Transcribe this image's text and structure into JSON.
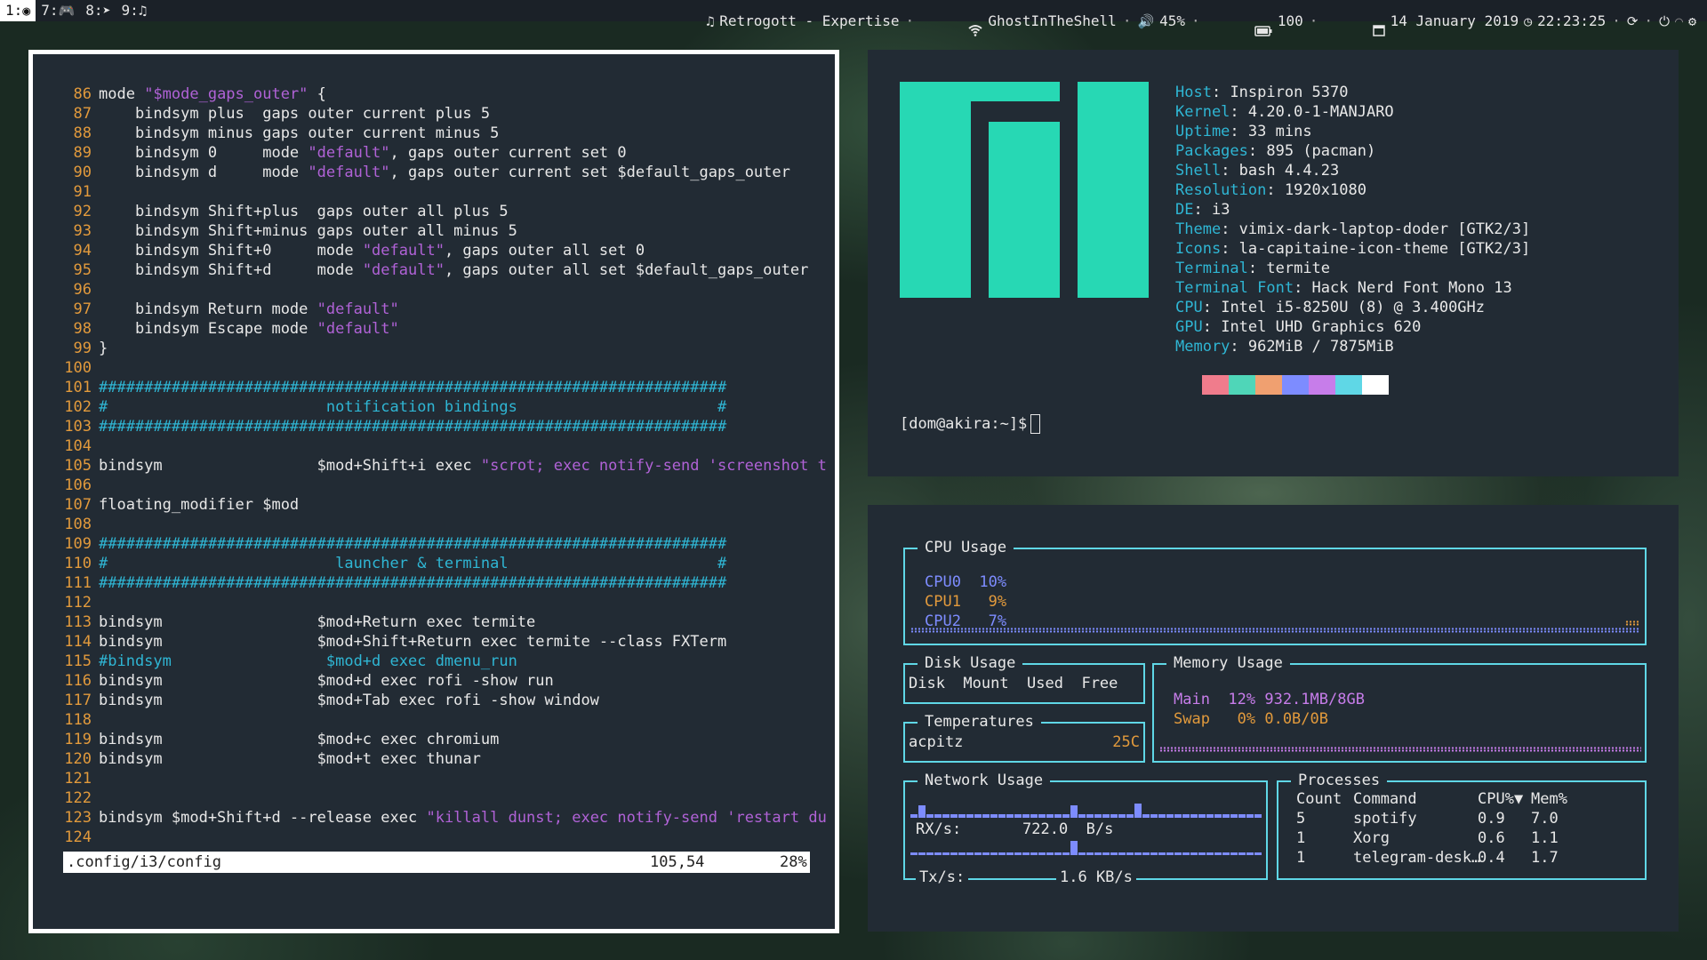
{
  "bar": {
    "workspaces": [
      {
        "label": "1:",
        "icon": "chrome-icon",
        "focused": true
      },
      {
        "label": "7:",
        "icon": "gamepad-icon",
        "focused": false
      },
      {
        "label": "8:",
        "icon": "send-icon",
        "focused": false
      },
      {
        "label": "9:",
        "icon": "music-icon",
        "focused": false
      }
    ],
    "now_playing": "Retrogott - Expertise",
    "wifi": "GhostInTheShell",
    "volume": "45%",
    "battery": "100",
    "date": "14 January 2019",
    "time": "22:23:25"
  },
  "editor": {
    "lines": [
      {
        "n": "86",
        "parts": [
          [
            "t",
            "mode "
          ],
          [
            "s",
            "\"$mode_gaps_outer\""
          ],
          [
            "t",
            " {"
          ]
        ]
      },
      {
        "n": "87",
        "parts": [
          [
            "t",
            "    bindsym plus  gaps outer current plus 5"
          ]
        ]
      },
      {
        "n": "88",
        "parts": [
          [
            "t",
            "    bindsym minus gaps outer current minus 5"
          ]
        ]
      },
      {
        "n": "89",
        "parts": [
          [
            "t",
            "    bindsym 0     mode "
          ],
          [
            "s",
            "\"default\""
          ],
          [
            "t",
            ", gaps outer current set 0"
          ]
        ]
      },
      {
        "n": "90",
        "parts": [
          [
            "t",
            "    bindsym d     mode "
          ],
          [
            "s",
            "\"default\""
          ],
          [
            "t",
            ", gaps outer current set $default_gaps_outer"
          ]
        ]
      },
      {
        "n": "91",
        "parts": []
      },
      {
        "n": "92",
        "parts": [
          [
            "t",
            "    bindsym Shift+plus  gaps outer all plus 5"
          ]
        ]
      },
      {
        "n": "93",
        "parts": [
          [
            "t",
            "    bindsym Shift+minus gaps outer all minus 5"
          ]
        ]
      },
      {
        "n": "94",
        "parts": [
          [
            "t",
            "    bindsym Shift+0     mode "
          ],
          [
            "s",
            "\"default\""
          ],
          [
            "t",
            ", gaps outer all set 0"
          ]
        ]
      },
      {
        "n": "95",
        "parts": [
          [
            "t",
            "    bindsym Shift+d     mode "
          ],
          [
            "s",
            "\"default\""
          ],
          [
            "t",
            ", gaps outer all set $default_gaps_outer"
          ]
        ]
      },
      {
        "n": "96",
        "parts": []
      },
      {
        "n": "97",
        "parts": [
          [
            "t",
            "    bindsym Return mode "
          ],
          [
            "s",
            "\"default\""
          ]
        ]
      },
      {
        "n": "98",
        "parts": [
          [
            "t",
            "    bindsym Escape mode "
          ],
          [
            "s",
            "\"default\""
          ]
        ]
      },
      {
        "n": "99",
        "parts": [
          [
            "t",
            "}"
          ]
        ]
      },
      {
        "n": "100",
        "parts": []
      },
      {
        "n": "101",
        "parts": [
          [
            "c",
            "#####################################################################"
          ]
        ]
      },
      {
        "n": "102",
        "parts": [
          [
            "c",
            "#                        notification bindings                      #"
          ]
        ]
      },
      {
        "n": "103",
        "parts": [
          [
            "c",
            "#####################################################################"
          ]
        ]
      },
      {
        "n": "104",
        "parts": []
      },
      {
        "n": "105",
        "parts": [
          [
            "t",
            "bindsym                 $mod+Shift+i exec "
          ],
          [
            "s",
            "\"scrot; exec notify-send 'screenshot t"
          ]
        ]
      },
      {
        "n": "106",
        "parts": []
      },
      {
        "n": "107",
        "parts": [
          [
            "t",
            "floating_modifier $mod"
          ]
        ]
      },
      {
        "n": "108",
        "parts": []
      },
      {
        "n": "109",
        "parts": [
          [
            "c",
            "#####################################################################"
          ]
        ]
      },
      {
        "n": "110",
        "parts": [
          [
            "c",
            "#                         launcher & terminal                       #"
          ]
        ]
      },
      {
        "n": "111",
        "parts": [
          [
            "c",
            "#####################################################################"
          ]
        ]
      },
      {
        "n": "112",
        "parts": []
      },
      {
        "n": "113",
        "parts": [
          [
            "t",
            "bindsym                 $mod+Return exec termite"
          ]
        ]
      },
      {
        "n": "114",
        "parts": [
          [
            "t",
            "bindsym                 $mod+Shift+Return exec termite --class FXTerm"
          ]
        ]
      },
      {
        "n": "115",
        "parts": [
          [
            "c",
            "#bindsym                 $mod+d exec dmenu_run"
          ]
        ]
      },
      {
        "n": "116",
        "parts": [
          [
            "t",
            "bindsym                 $mod+d exec rofi -show run"
          ]
        ]
      },
      {
        "n": "117",
        "parts": [
          [
            "t",
            "bindsym                 $mod+Tab exec rofi -show window"
          ]
        ]
      },
      {
        "n": "118",
        "parts": []
      },
      {
        "n": "119",
        "parts": [
          [
            "t",
            "bindsym                 $mod+c exec chromium"
          ]
        ]
      },
      {
        "n": "120",
        "parts": [
          [
            "t",
            "bindsym                 $mod+t exec thunar"
          ]
        ]
      },
      {
        "n": "121",
        "parts": []
      },
      {
        "n": "122",
        "parts": []
      },
      {
        "n": "123",
        "parts": [
          [
            "t",
            "bindsym $mod+Shift+d --release exec "
          ],
          [
            "s",
            "\"killall dunst; exec notify-send 'restart du"
          ]
        ]
      },
      {
        "n": "124",
        "parts": []
      }
    ],
    "status": {
      "file": ".config/i3/config",
      "pos": "105,54",
      "percent": "28%"
    }
  },
  "neofetch": {
    "info": [
      [
        "Host",
        "Inspiron 5370"
      ],
      [
        "Kernel",
        "4.20.0-1-MANJARO"
      ],
      [
        "Uptime",
        "33 mins"
      ],
      [
        "Packages",
        "895 (pacman)"
      ],
      [
        "Shell",
        "bash 4.4.23"
      ],
      [
        "Resolution",
        "1920x1080"
      ],
      [
        "DE",
        "i3"
      ],
      [
        "Theme",
        "vimix-dark-laptop-doder [GTK2/3]"
      ],
      [
        "Icons",
        "la-capitaine-icon-theme [GTK2/3]"
      ],
      [
        "Terminal",
        "termite"
      ],
      [
        "Terminal Font",
        "Hack Nerd Font Mono 13"
      ],
      [
        "CPU",
        "Intel i5-8250U (8) @ 3.400GHz"
      ],
      [
        "GPU",
        "Intel UHD Graphics 620"
      ],
      [
        "Memory",
        "962MiB / 7875MiB"
      ]
    ],
    "palette": [
      "#222b34",
      "#f07c8c",
      "#4fd6b8",
      "#f0a070",
      "#7d8cff",
      "#c77dea",
      "#5fd7e6",
      "#ffffff"
    ],
    "prompt": "[dom@akira:~]$"
  },
  "gotop": {
    "cpu": {
      "title": "CPU Usage",
      "rows": [
        {
          "name": "CPU0",
          "value": "10%",
          "color": "#7d8cff"
        },
        {
          "name": "CPU1",
          "value": "9%",
          "color": "#e29a3c"
        },
        {
          "name": "CPU2",
          "value": "7%",
          "color": "#7d8cff"
        }
      ]
    },
    "disk": {
      "title": "Disk Usage",
      "header": "Disk  Mount  Used  Free"
    },
    "temps": {
      "title": "Temperatures",
      "sensor": "acpitz",
      "value": "25C"
    },
    "memory": {
      "title": "Memory Usage",
      "rows": [
        {
          "label": "Main",
          "pct": "12%",
          "value": "932.1MB/8GB",
          "color": "#c77dea"
        },
        {
          "label": "Swap",
          "pct": "0%",
          "value": "0.0B/0B",
          "color": "#e29a3c"
        }
      ]
    },
    "network": {
      "title": "Network Usage",
      "rx_label": "RX/s:",
      "rx_value": "722.0  B/s",
      "tx_label": "Tx/s:",
      "tx_value": "1.6 KB/s"
    },
    "processes": {
      "title": "Processes",
      "headers": [
        "Count",
        "Command",
        "CPU%▼",
        "Mem%"
      ],
      "rows": [
        [
          "5",
          "spotify",
          "0.9",
          "7.0"
        ],
        [
          "1",
          "Xorg",
          "0.6",
          "1.1"
        ],
        [
          "1",
          "telegram-desk…",
          "0.4",
          "1.7"
        ]
      ]
    }
  }
}
